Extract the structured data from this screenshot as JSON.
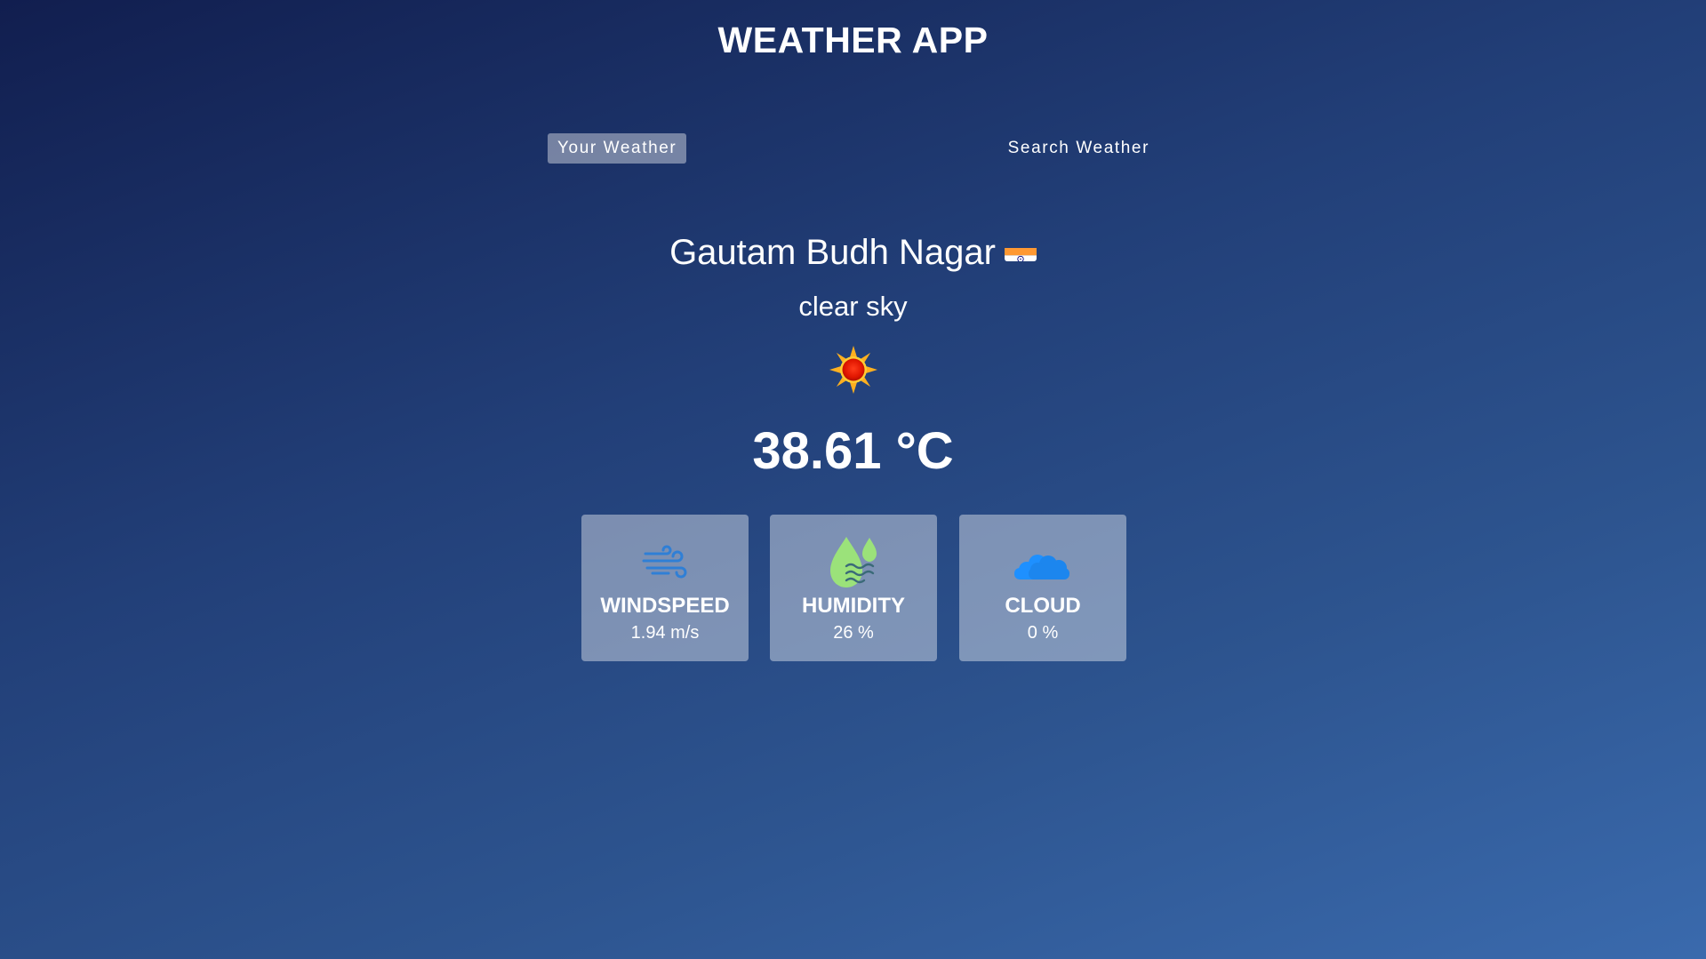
{
  "header": {
    "title": "WEATHER APP"
  },
  "tabs": [
    {
      "label": "Your Weather",
      "active": true
    },
    {
      "label": "Search Weather",
      "active": false
    }
  ],
  "location": {
    "city": "Gautam Budh Nagar",
    "flag_icon": "india-flag-icon"
  },
  "weather": {
    "description": "clear sky",
    "icon": "sun-icon",
    "temperature": "38.61 °C"
  },
  "stats": [
    {
      "title": "WINDSPEED",
      "value": "1.94 m/s",
      "icon": "wind-icon"
    },
    {
      "title": "HUMIDITY",
      "value": "26 %",
      "icon": "humidity-icon"
    },
    {
      "title": "CLOUD",
      "value": "0 %",
      "icon": "cloud-icon"
    }
  ],
  "colors": {
    "background_top": "#111e4f",
    "background_bottom": "#3a6aad",
    "card_background": "rgba(255,255,255,0.4)",
    "wind_icon": "#2f7fd6",
    "humidity_icon": "#9be27a",
    "cloud_icon": "#1e90ff"
  }
}
